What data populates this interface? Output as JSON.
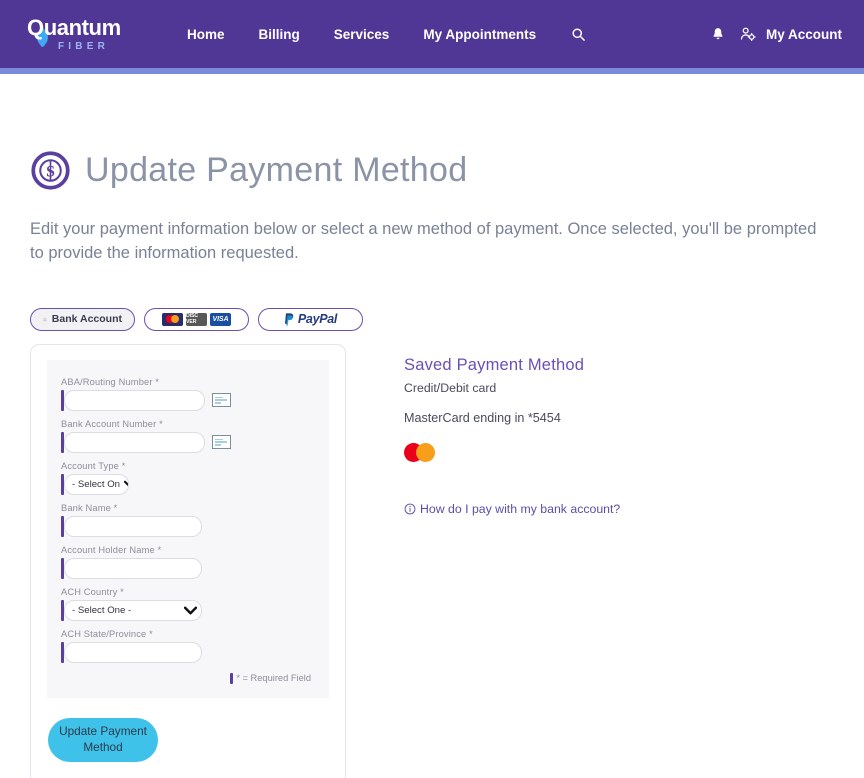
{
  "nav": {
    "logo_word": "Quantum",
    "logo_sub": "FIBER",
    "links": [
      {
        "label": "Home"
      },
      {
        "label": "Billing"
      },
      {
        "label": "Services"
      },
      {
        "label": "My Appointments"
      }
    ],
    "search_icon": "search-icon",
    "bell_icon": "bell-icon",
    "account_icon": "account-settings-icon",
    "account_label": "My Account",
    "bar_color": "#503795",
    "underline_color": "#7b8bdc"
  },
  "header": {
    "icon": "dollar-circle-icon",
    "title": "Update Payment Method",
    "description": "Edit your payment information below or select a new method of payment. Once selected, you'll be prompted to provide the information requested."
  },
  "tabs": [
    {
      "id": "bank-account",
      "label": "Bank Account",
      "icon": "bank-icon",
      "selected": true
    },
    {
      "id": "credit-card",
      "label": "",
      "icons": [
        "mastercard-logo",
        "discover-logo",
        "visa-logo"
      ],
      "selected": false
    },
    {
      "id": "paypal",
      "label": "PayPal",
      "icon": "paypal-logo",
      "selected": false
    }
  ],
  "card_logos": {
    "mastercard": "mastercard",
    "discover": "DISC VER",
    "visa": "VISA",
    "paypal": "PayPal"
  },
  "form": {
    "fields": [
      {
        "label": "ABA/Routing Number *",
        "value": "",
        "type": "text",
        "has_check_icon": true
      },
      {
        "label": "Bank Account Number *",
        "value": "",
        "type": "text",
        "has_check_icon": true
      },
      {
        "label": "Account Type *",
        "value": "- Select On",
        "type": "select",
        "has_check_icon": false
      },
      {
        "label": "Bank Name *",
        "value": "",
        "type": "text",
        "has_check_icon": false
      },
      {
        "label": "Account Holder Name *",
        "value": "",
        "type": "text",
        "has_check_icon": false
      },
      {
        "label": "ACH Country *",
        "value": "- Select One -",
        "type": "select",
        "has_check_icon": false
      },
      {
        "label": "ACH State/Province *",
        "value": "",
        "type": "text",
        "has_check_icon": false
      }
    ],
    "required_note": "* = Required Field",
    "submit_label": "Update Payment Method",
    "submit_color": "#3ec2ea"
  },
  "saved": {
    "title": "Saved Payment Method",
    "subtitle": "Credit/Debit card",
    "card_line": "MasterCard ending in *5454",
    "brand_icon": "mastercard-logo",
    "help_icon": "info-circle-icon",
    "help_label": "How do I pay with my bank account?"
  }
}
